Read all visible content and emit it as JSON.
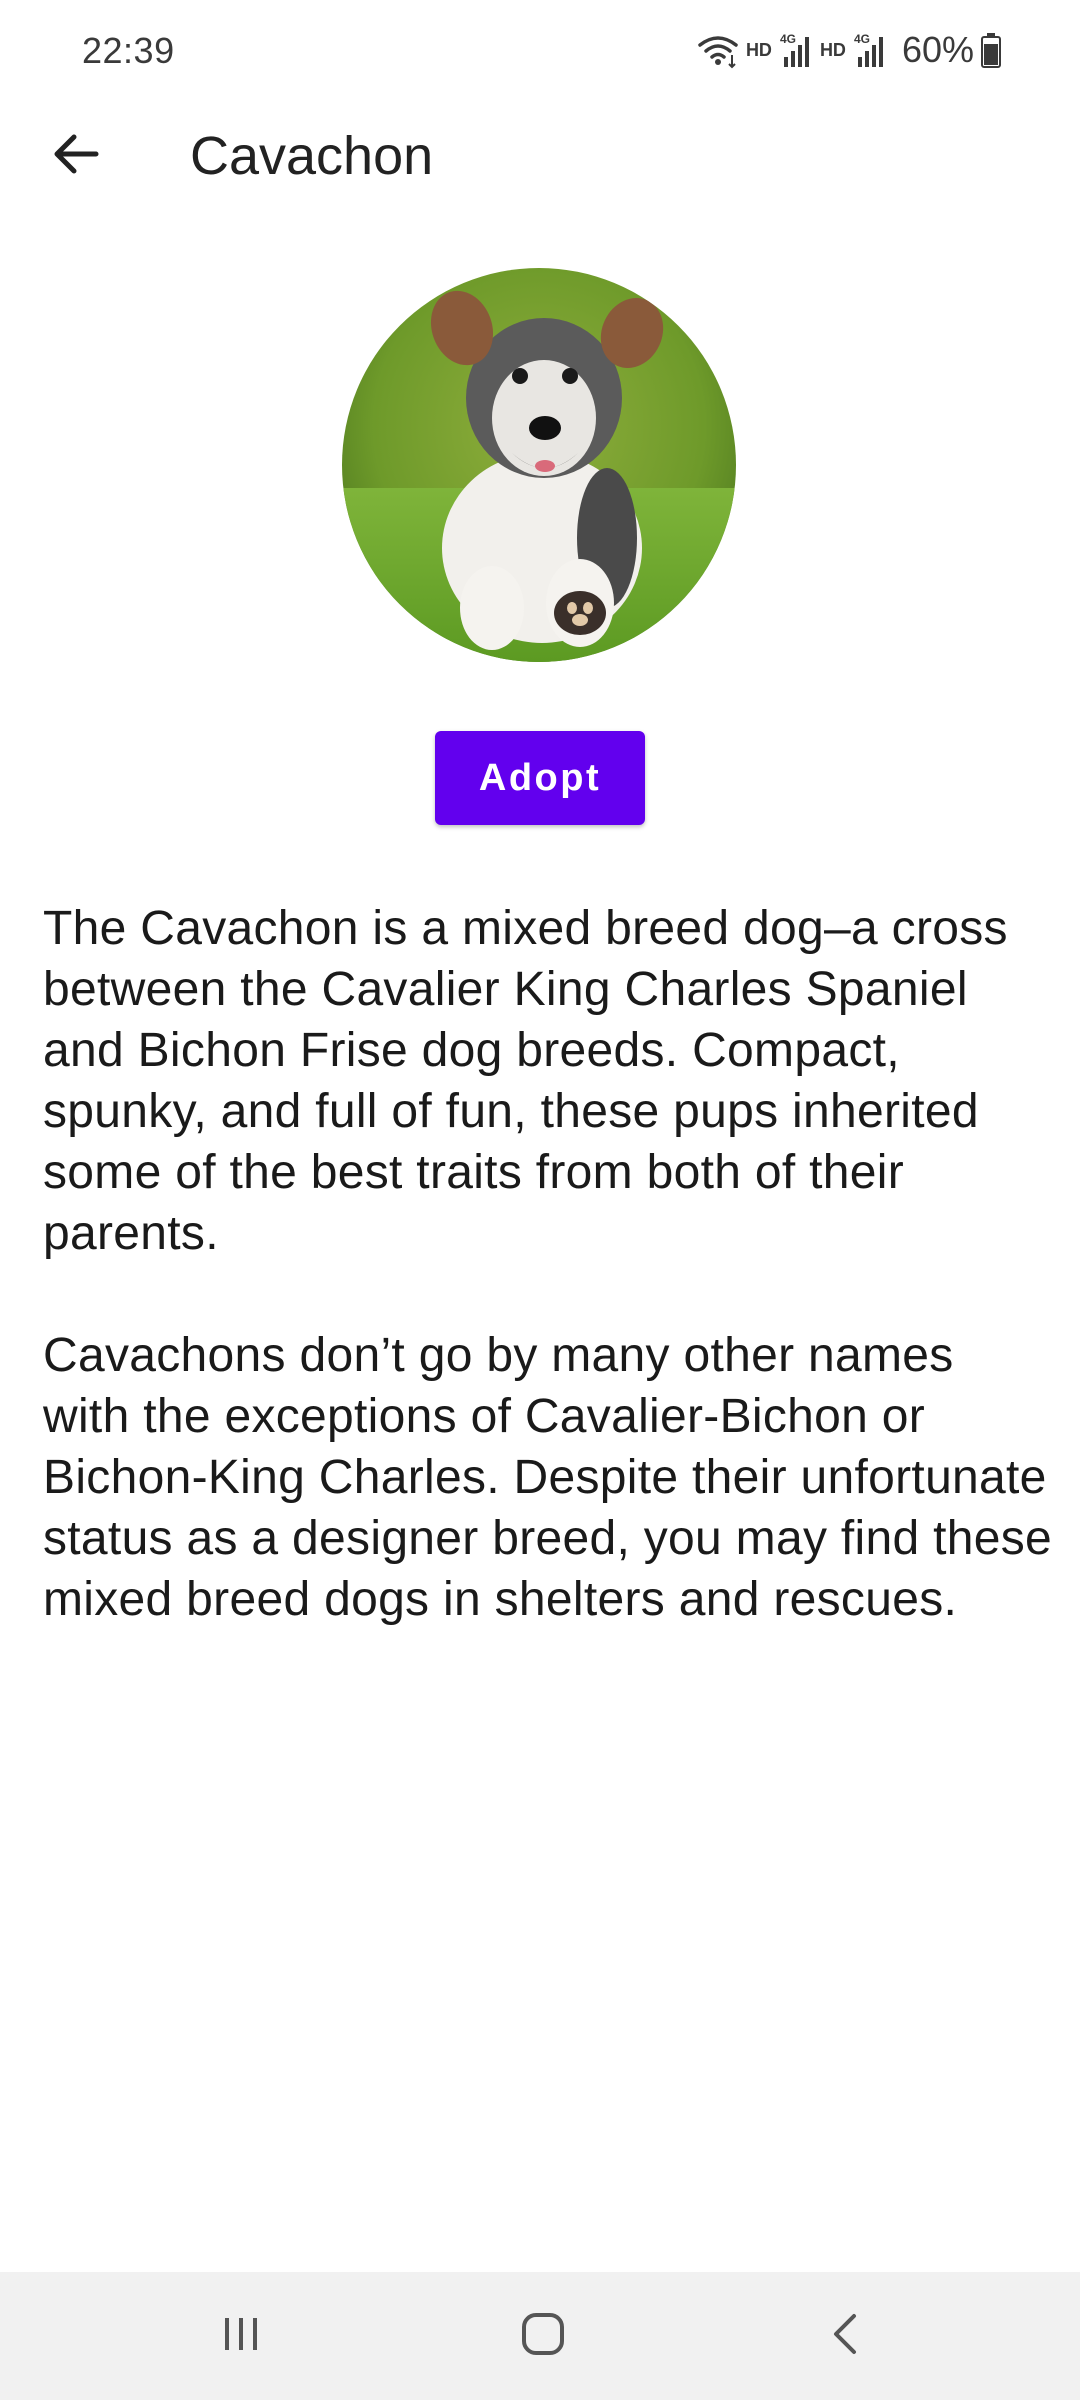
{
  "status_bar": {
    "time": "22:39",
    "network_1": "HD",
    "network_2": "HD",
    "signal_label_1": "4G",
    "signal_label_2": "4G",
    "battery": "60%",
    "icons": [
      "wifi-icon",
      "signal-icon",
      "signal-icon",
      "battery-icon"
    ]
  },
  "app_bar": {
    "title": "Cavachon",
    "back_icon": "arrow-left-icon"
  },
  "image": {
    "alt": "Cavachon"
  },
  "actions": {
    "adopt_label": "Adopt"
  },
  "description": {
    "paragraphs": [
      "The Cavachon is a mixed breed dog–a cross between the Cavalier King Charles Spaniel and Bichon Frise dog breeds. Compact, spunky, and full of fun, these pups inherited some of the best traits from both of their parents.",
      "Cavachons don’t go by many other names with the exceptions of Cavalier-Bichon or Bichon-King Charles. Despite their unfortunate status as a designer breed, you may find these mixed breed dogs in shelters and rescues."
    ]
  },
  "nav_bar": {
    "recents_icon": "recents-icon",
    "home_icon": "home-icon",
    "back_icon": "chevron-left-icon"
  },
  "colors": {
    "accent": "#6200ee",
    "nav_background": "#f1f1f1",
    "text": "#1a1a1a"
  }
}
